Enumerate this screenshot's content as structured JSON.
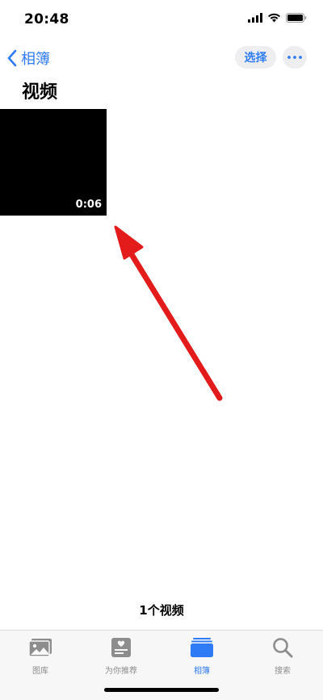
{
  "status_bar": {
    "time": "20:48",
    "icons": [
      "cellular-signal-icon",
      "wifi-icon",
      "battery-icon"
    ]
  },
  "nav": {
    "back_label": "相簿",
    "select_label": "选择",
    "more_icon": "ellipsis-icon"
  },
  "page": {
    "title": "视频"
  },
  "videos": [
    {
      "duration": "0:06"
    }
  ],
  "summary": {
    "count_label": "1个视频"
  },
  "tab_bar": {
    "tabs": [
      {
        "label": "图库",
        "icon": "photo-library-icon",
        "active": false
      },
      {
        "label": "为你推荐",
        "icon": "for-you-icon",
        "active": false
      },
      {
        "label": "相簿",
        "icon": "albums-icon",
        "active": true
      },
      {
        "label": "搜索",
        "icon": "search-icon",
        "active": false
      }
    ]
  },
  "colors": {
    "accent": "#2f7bf6",
    "annotation_arrow": "#e31b1b",
    "tab_inactive": "#8d8d8d"
  }
}
